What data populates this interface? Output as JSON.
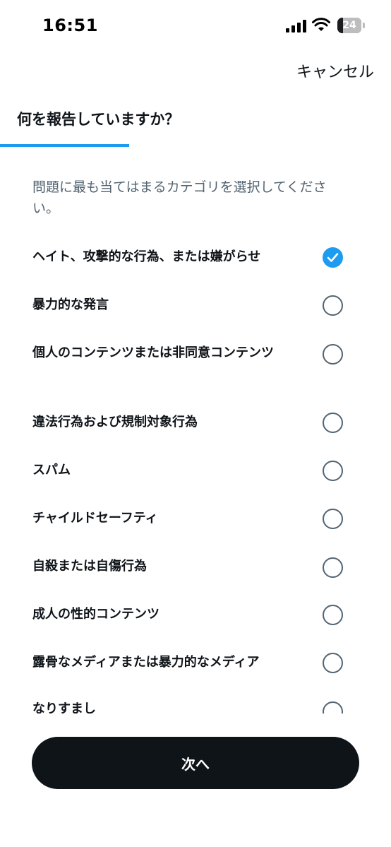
{
  "status_bar": {
    "time": "16:51",
    "battery": "24"
  },
  "header": {
    "cancel_label": "キャンセル",
    "title": "何を報告していますか？"
  },
  "progress": {
    "fraction": 0.33
  },
  "description": "問題に最も当てはまるカテゴリを選択してください。",
  "options": [
    {
      "label": "ヘイト、攻撃的な行為、または嫌がらせ",
      "selected": true
    },
    {
      "label": "暴力的な発言",
      "selected": false
    },
    {
      "label": "個人のコンテンツまたは非同意コンテンツ",
      "selected": false
    },
    {
      "label": "違法行為および規制対象行為",
      "selected": false
    },
    {
      "label": "スパム",
      "selected": false
    },
    {
      "label": "チャイルドセーフティ",
      "selected": false
    },
    {
      "label": "自殺または自傷行為",
      "selected": false
    },
    {
      "label": "成人の性的コンテンツ",
      "selected": false
    },
    {
      "label": "露骨なメディアまたは暴力的なメディア",
      "selected": false
    },
    {
      "label": "なりすまし",
      "selected": false
    }
  ],
  "footer": {
    "next_label": "次へ"
  },
  "colors": {
    "accent": "#1d9bf0",
    "text": "#0f1419",
    "muted": "#536471",
    "button": "#0f1419"
  },
  "icons": [
    "signal-icon",
    "wifi-icon",
    "battery-icon",
    "check-icon"
  ]
}
